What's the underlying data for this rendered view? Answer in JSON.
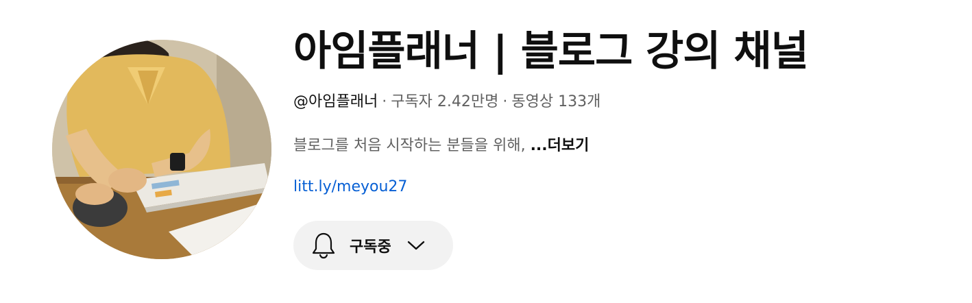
{
  "channel": {
    "title": "아임플래너 | 블로그 강의 채널",
    "handle": "@아임플래너",
    "subscribers": "구독자 2.42만명",
    "videos": "동영상 133개",
    "separator": "·",
    "description": "블로그를 처음 시작하는 분들을 위해, ",
    "more_label": "...더보기",
    "link": "litt.ly/meyou27"
  },
  "subscribe_button": {
    "label": "구독중",
    "icon": "bell-icon",
    "dropdown_icon": "chevron-down-icon"
  },
  "colors": {
    "link": "#065fd4",
    "secondary_text": "#606060",
    "primary_text": "#0f0f0f",
    "button_bg": "#f2f2f2"
  }
}
